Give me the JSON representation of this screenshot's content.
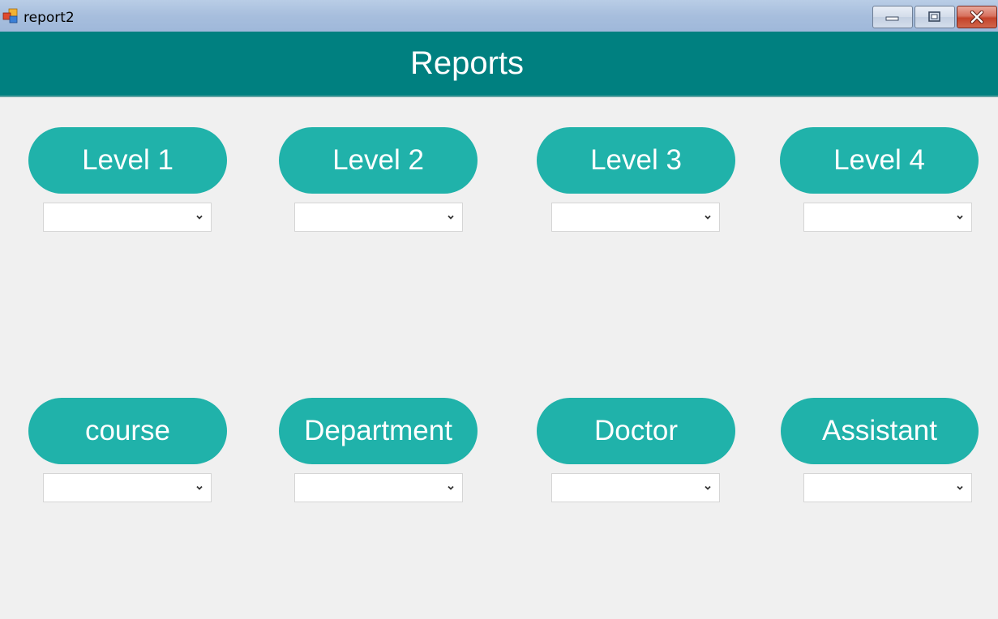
{
  "window": {
    "title": "report2",
    "controls": [
      "minimize",
      "maximize",
      "close"
    ]
  },
  "header": {
    "title": "Reports",
    "color": "#008080"
  },
  "accent": "#20b2aa",
  "reports": [
    {
      "label": "Level 1",
      "selected": ""
    },
    {
      "label": "Level 2",
      "selected": ""
    },
    {
      "label": "Level 3",
      "selected": ""
    },
    {
      "label": "Level 4",
      "selected": ""
    },
    {
      "label": "course",
      "selected": ""
    },
    {
      "label": "Department",
      "selected": ""
    },
    {
      "label": "Doctor",
      "selected": ""
    },
    {
      "label": "Assistant",
      "selected": ""
    }
  ],
  "icons": {
    "app": "app-icon",
    "dropdown": "chevron-down-icon"
  }
}
